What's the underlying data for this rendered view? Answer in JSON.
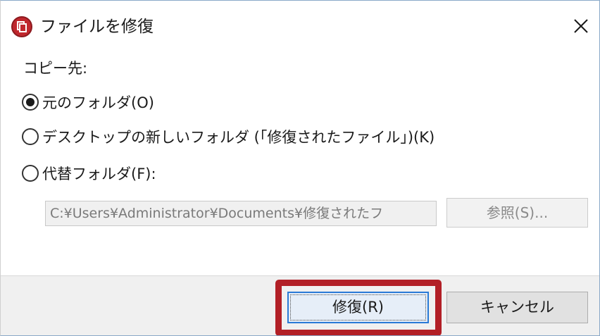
{
  "window": {
    "title": "ファイルを修復",
    "close_glyph": "✕",
    "icon": "app-logo-icon"
  },
  "destination": {
    "label": "コピー先:",
    "options": [
      {
        "label": "元のフォルダ(O)",
        "selected": true
      },
      {
        "label": "デスクトップの新しいフォルダ (「修復されたファイル」)(K)",
        "selected": false
      },
      {
        "label": "代替フォルダ(F):",
        "selected": false
      }
    ],
    "path_value": "C:¥Users¥Administrator¥Documents¥修復されたフ",
    "browse_label": "参照(S)..."
  },
  "footer": {
    "repair_label": "修復(R)",
    "cancel_label": "キャンセル"
  },
  "colors": {
    "highlight": "#b21f26",
    "icon_red": "#c0272d",
    "focus_blue": "#2a7ad6"
  }
}
